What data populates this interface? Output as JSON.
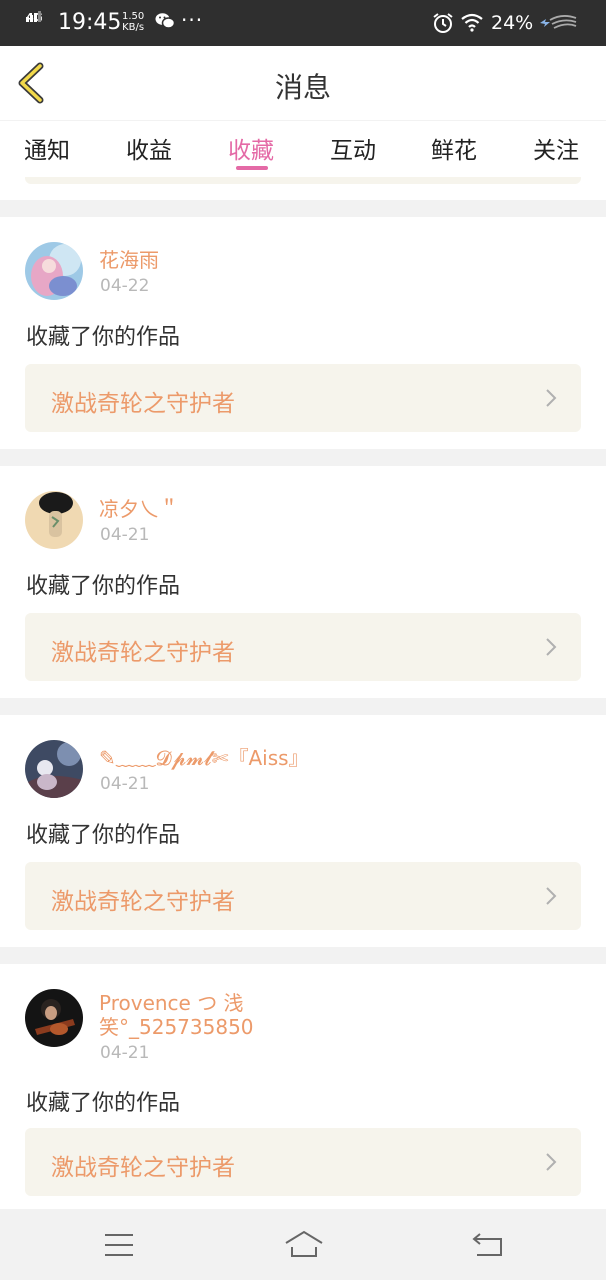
{
  "status_bar": {
    "network": "4G",
    "time": "19:45",
    "speed_value": "1.50",
    "speed_unit": "KB/s",
    "more": "···",
    "battery": "24%",
    "icons": [
      "signal-icon",
      "wechat-icon",
      "alarm-icon",
      "wifi-icon",
      "charging-icon"
    ]
  },
  "header": {
    "title": "消息",
    "back_icon": "chevron-left-icon",
    "back_color": "#c9a227"
  },
  "tabs": [
    {
      "label": "通知"
    },
    {
      "label": "收益"
    },
    {
      "label": "收藏",
      "active": true
    },
    {
      "label": "互动"
    },
    {
      "label": "鲜花"
    },
    {
      "label": "关注"
    }
  ],
  "accent_color": "#e46aa6",
  "name_color": "#ec9a6a",
  "messages": [
    {
      "user": "花海雨",
      "date": "04-22",
      "action": "收藏了你的作品",
      "work": "激战奇轮之守护者"
    },
    {
      "user": "凉夕乀＂",
      "date": "04-21",
      "action": "收藏了你的作品",
      "work": "激战奇轮之守护者"
    },
    {
      "user": "✎﹏﹏𝓓𝓹𝓶𝓵✄『Aiss』",
      "date": "04-21",
      "action": "收藏了你的作品",
      "work": "激战奇轮之守护者"
    },
    {
      "user": "Provence つ 浅笑°_525735850",
      "date": "04-21",
      "action": "收藏了你的作品",
      "work": "激战奇轮之守护者"
    }
  ],
  "nav": {
    "icons": [
      "menu-icon",
      "home-icon",
      "back-icon"
    ]
  }
}
